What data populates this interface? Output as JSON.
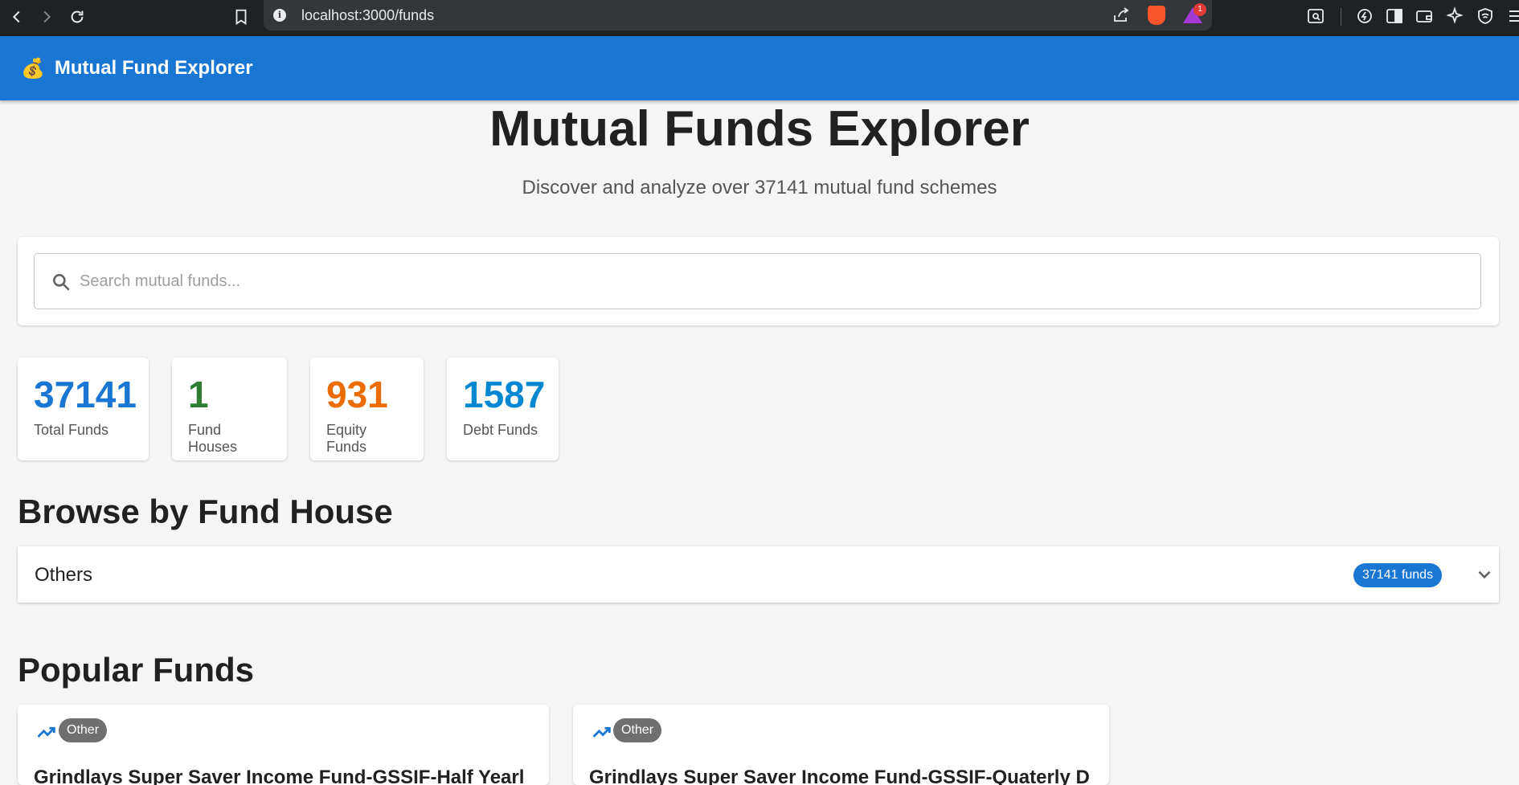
{
  "browser": {
    "url": "localhost:3000/funds",
    "rewards_badge": "1"
  },
  "appbar": {
    "logo": "💰",
    "title": "Mutual Fund Explorer"
  },
  "hero": {
    "title": "Mutual Funds Explorer",
    "subtitle": "Discover and analyze over 37141 mutual fund schemes"
  },
  "search": {
    "placeholder": "Search mutual funds...",
    "value": ""
  },
  "stats": [
    {
      "value": "37141",
      "label": "Total Funds",
      "color": "#1976d2"
    },
    {
      "value": "1",
      "label": "Fund Houses",
      "color": "#2e7d32"
    },
    {
      "value": "931",
      "label": "Equity Funds",
      "color": "#ed6c02"
    },
    {
      "value": "1587",
      "label": "Debt Funds",
      "color": "#0288d1"
    }
  ],
  "browse": {
    "heading": "Browse by Fund House",
    "houses": [
      {
        "name": "Others",
        "count_label": "37141 funds"
      }
    ]
  },
  "popular": {
    "heading": "Popular Funds",
    "funds": [
      {
        "category": "Other",
        "name": "Grindlays Super Saver Income Fund-GSSIF-Half Yearl"
      },
      {
        "category": "Other",
        "name": "Grindlays Super Saver Income Fund-GSSIF-Quaterly D"
      }
    ]
  },
  "colors": {
    "primary": "#1976d2",
    "background": "#f5f5f5",
    "browser_chrome": "#202124"
  }
}
